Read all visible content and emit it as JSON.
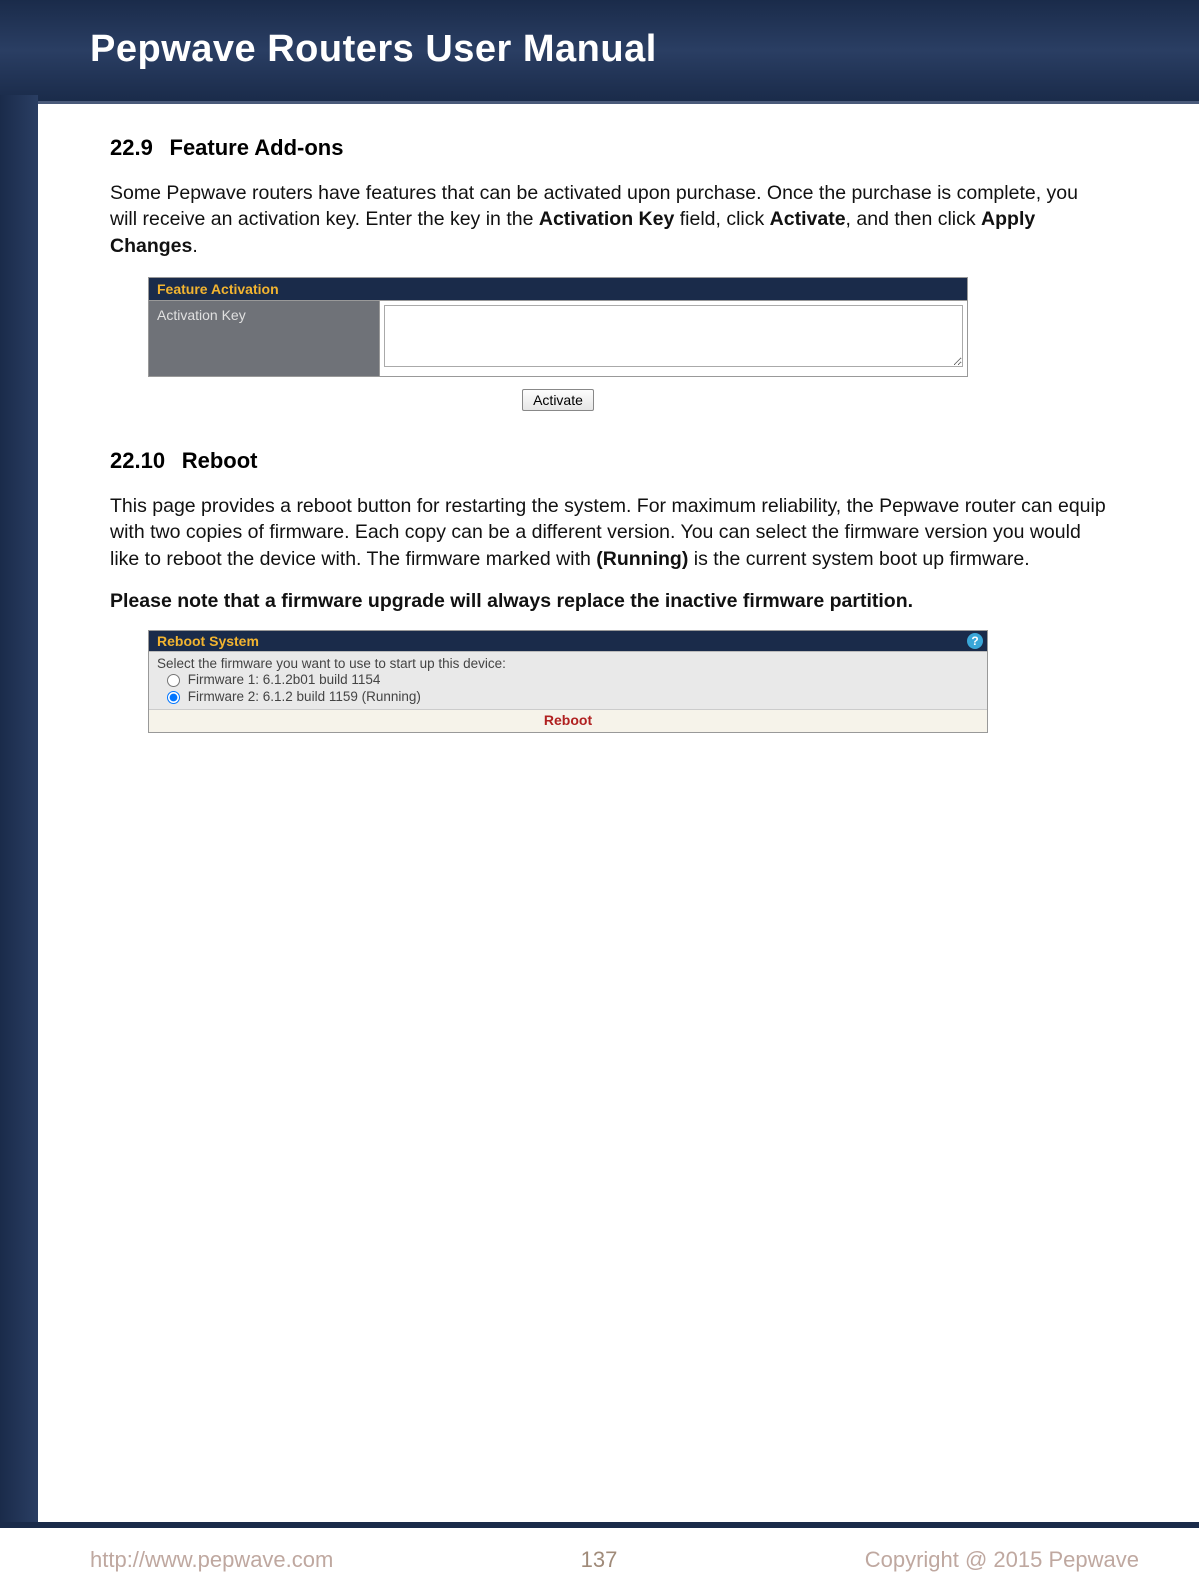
{
  "header": {
    "title": "Pepwave Routers User Manual"
  },
  "section1": {
    "num": "22.9",
    "title": "Feature Add-ons",
    "para_pre": "Some Pepwave routers have features that can be activated upon purchase. Once the purchase is complete, you will receive an activation key. Enter the key in the ",
    "bold1": "Activation Key",
    "mid1": " field, click ",
    "bold2": "Activate",
    "mid2": ", and then click ",
    "bold3": "Apply Changes",
    "end": "."
  },
  "feature_panel": {
    "header": "Feature Activation",
    "label": "Activation Key",
    "button": "Activate"
  },
  "section2": {
    "num": "22.10",
    "title": "Reboot",
    "para_pre": "This page provides a reboot button for restarting the system. For maximum reliability, the Pepwave router can equip with two copies of firmware. Each copy can be a different version. You can select the firmware version you would like to reboot the device with. The firmware marked with ",
    "bold1": "(Running)",
    "para_post": " is the current system boot up firmware.",
    "note": "Please note that a firmware upgrade will always replace the inactive firmware partition."
  },
  "reboot_panel": {
    "header": "Reboot System",
    "help": "?",
    "instruction": "Select the firmware you want to use to start up this device:",
    "fw1": "Firmware 1: 6.1.2b01 build 1154",
    "fw2": "Firmware 2: 6.1.2 build 1159 (Running)",
    "button": "Reboot"
  },
  "footer": {
    "url": "http://www.pepwave.com",
    "page": "137",
    "copyright": "Copyright @ 2015 Pepwave"
  }
}
